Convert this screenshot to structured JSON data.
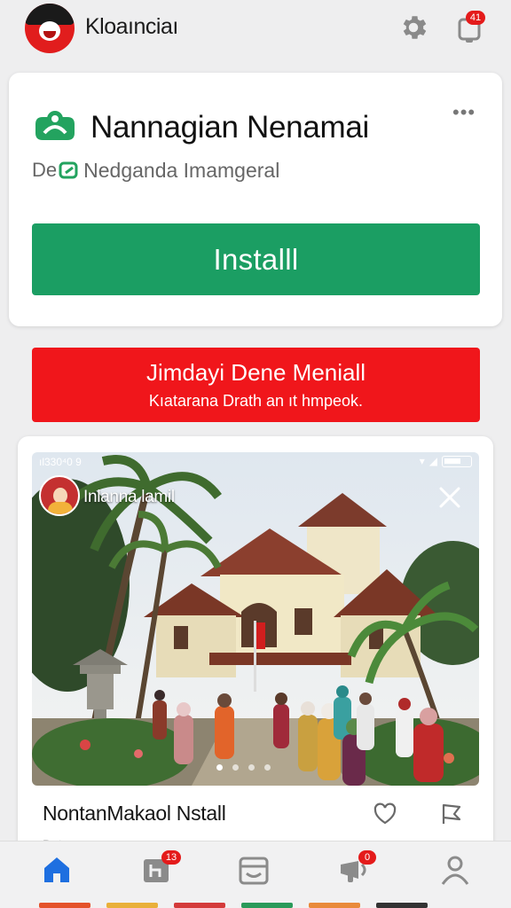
{
  "header": {
    "app_title": "Kloaınciaı",
    "settings_icon": "gear-icon",
    "notifications_icon": "bell-icon",
    "notification_badge": "41"
  },
  "install_card": {
    "app_name": "Nannagian Nenamai",
    "developer_prefix": "De",
    "developer_name": "Nedganda Imamgeral",
    "more_icon": "more-horizontal-icon",
    "more_label": "•••",
    "install_label": "Installl",
    "accent_color": "#1b9e63"
  },
  "promo": {
    "title": "Jimdayi Dene Meniall",
    "subtitle": "Kıatarana Drath an ıt hmpeok.",
    "color": "#f0161b"
  },
  "post": {
    "status_time": "ıl330⁴0 9",
    "story_name": "Inlanna lamil",
    "title": "NontanMakaol Nstall",
    "subtitle": "Detannn...",
    "slide_count": 4,
    "active_slide": 0,
    "like_icon": "heart-icon",
    "share_icon": "flag-icon"
  },
  "bottom_nav": {
    "items": [
      {
        "name": "home",
        "icon": "home-icon",
        "active": true
      },
      {
        "name": "feed",
        "icon": "feed-icon",
        "badge": "13"
      },
      {
        "name": "inbox",
        "icon": "inbox-icon"
      },
      {
        "name": "alerts",
        "icon": "megaphone-icon",
        "badge": "0"
      },
      {
        "name": "profile",
        "icon": "user-icon"
      }
    ],
    "active_color": "#1e6fe0"
  }
}
